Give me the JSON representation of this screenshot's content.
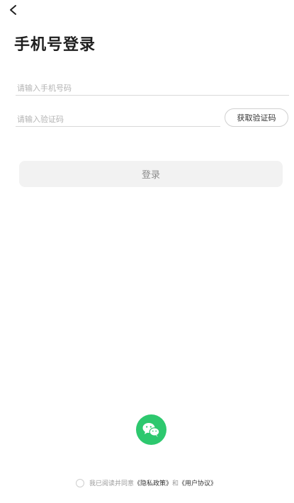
{
  "page": {
    "title": "手机号登录"
  },
  "form": {
    "phone_placeholder": "请输入手机号码",
    "phone_value": "",
    "code_placeholder": "请输入验证码",
    "code_value": "",
    "get_code_label": "获取验证码",
    "login_label": "登录"
  },
  "agreement": {
    "prefix": "我已阅读并同意",
    "privacy_link": "《隐私政策》",
    "conjunction": "和",
    "user_link": "《用户协议》",
    "checked": false
  },
  "icons": {
    "back": "chevron-left-icon",
    "wechat": "wechat-icon"
  },
  "colors": {
    "wechat_green": "#2dc86e",
    "login_bg": "#f2f2f2",
    "login_text": "#8c8c8c"
  }
}
